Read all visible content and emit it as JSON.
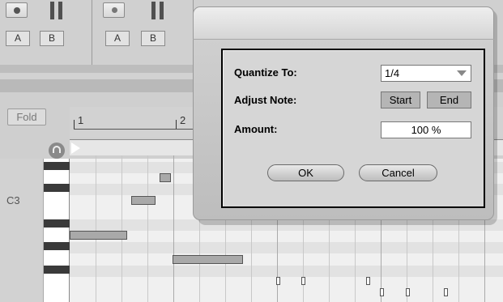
{
  "clip_view": {
    "slot_a_label": "A",
    "slot_b_label": "B",
    "slot2_a_label": "A",
    "slot2_b_label": "B"
  },
  "piano_roll": {
    "fold_label": "Fold",
    "ruler": [
      "1",
      "2"
    ],
    "pitch_label": "C3"
  },
  "dialog": {
    "quantize_label": "Quantize To:",
    "quantize_value": "1/4",
    "adjust_label": "Adjust Note:",
    "start_label": "Start",
    "end_label": "End",
    "amount_label": "Amount:",
    "amount_value": "100 %",
    "ok_label": "OK",
    "cancel_label": "Cancel"
  },
  "colors": {
    "dialog_bg": "#d6d6d6",
    "note_fill": "#a9a9a9",
    "key_black": "#3a3a3a"
  }
}
